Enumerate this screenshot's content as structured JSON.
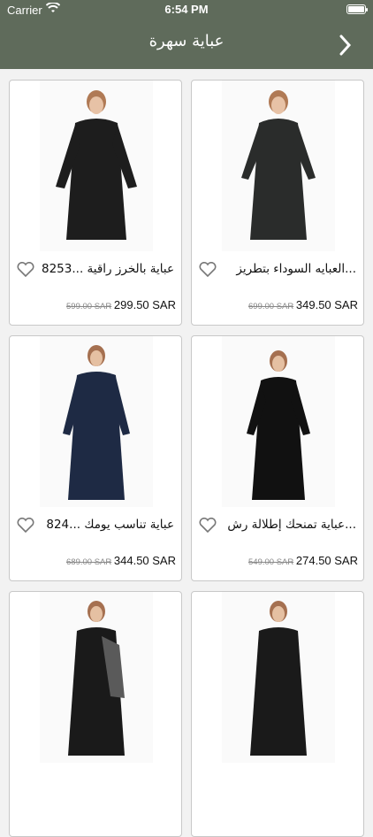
{
  "status_bar": {
    "carrier": "Carrier",
    "time": "6:54 PM"
  },
  "header": {
    "title": "عباية سهرة"
  },
  "products": [
    {
      "name": "العبايه السوداء بتطريز...",
      "price": "349.50 SAR",
      "old_price": "699.00 SAR",
      "dress_color": "#2a2c2b"
    },
    {
      "name": "عباية بالخرز راقية ...8253",
      "price": "299.50 SAR",
      "old_price": "599.00 SAR",
      "dress_color": "#1d1d1d"
    },
    {
      "name": "عباية تمنحك إطلالة رش...",
      "price": "274.50 SAR",
      "old_price": "549.00 SAR",
      "dress_color": "#111"
    },
    {
      "name": "عباية تناسب يومك ...824",
      "price": "344.50 SAR",
      "old_price": "689.00 SAR",
      "dress_color": "#1e2a44"
    },
    {
      "name": "",
      "price": "",
      "old_price": "",
      "dress_color": "#1a1a1a"
    },
    {
      "name": "",
      "price": "",
      "old_price": "",
      "dress_color": "#1a1a1a"
    }
  ],
  "colors": {
    "header": "#5f6b5b",
    "background": "#f2f2f2"
  }
}
